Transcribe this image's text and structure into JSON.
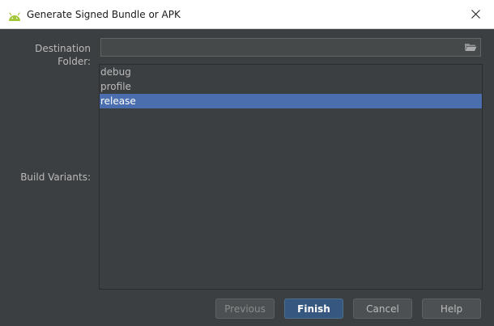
{
  "window": {
    "title": "Generate Signed Bundle or APK",
    "app_icon": "android-icon",
    "close_icon": "close-icon"
  },
  "destination": {
    "label": "Destination Folder:",
    "value": "",
    "browse_icon": "folder-icon"
  },
  "build_variants": {
    "label": "Build Variants:",
    "items": [
      {
        "label": "debug",
        "selected": false
      },
      {
        "label": "profile",
        "selected": false
      },
      {
        "label": "release",
        "selected": true
      }
    ]
  },
  "buttons": {
    "previous": "Previous",
    "finish": "Finish",
    "cancel": "Cancel",
    "help": "Help"
  },
  "colors": {
    "android_green": "#a4c639",
    "selection": "#4b6eaf",
    "default_button": "#365880"
  }
}
